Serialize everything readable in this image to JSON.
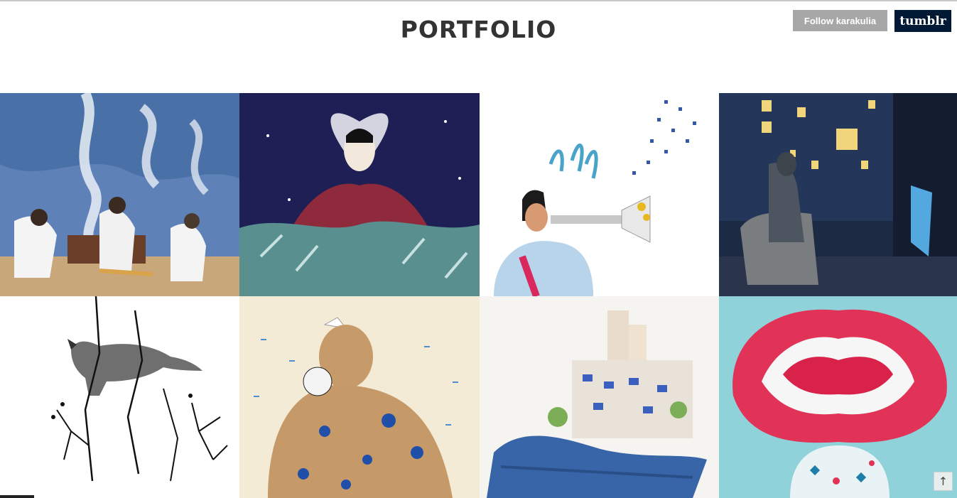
{
  "header": {
    "title": "PORTFOLIO",
    "follow_label": "Follow karakulia",
    "tumblr_label": "tumblr",
    "colors": {
      "follow_bg": "#a7a7a7",
      "tumblr_bg": "#001935",
      "title": "#333333"
    }
  },
  "gallery": {
    "items": [
      {
        "name": "smoking-men-illustration",
        "icon": "image-thumbnail"
      },
      {
        "name": "lace-collar-queen-illustration",
        "icon": "image-thumbnail"
      },
      {
        "name": "trumpet-player-illustration",
        "icon": "image-thumbnail"
      },
      {
        "name": "night-window-figure-illustration",
        "icon": "image-thumbnail"
      },
      {
        "name": "fox-branches-illustration",
        "icon": "image-thumbnail"
      },
      {
        "name": "tattooed-sailor-illustration",
        "icon": "image-thumbnail"
      },
      {
        "name": "boat-town-illustration",
        "icon": "image-thumbnail"
      },
      {
        "name": "red-flower-head-illustration",
        "icon": "image-thumbnail"
      }
    ]
  },
  "controls": {
    "scroll_top_icon": "↑"
  }
}
